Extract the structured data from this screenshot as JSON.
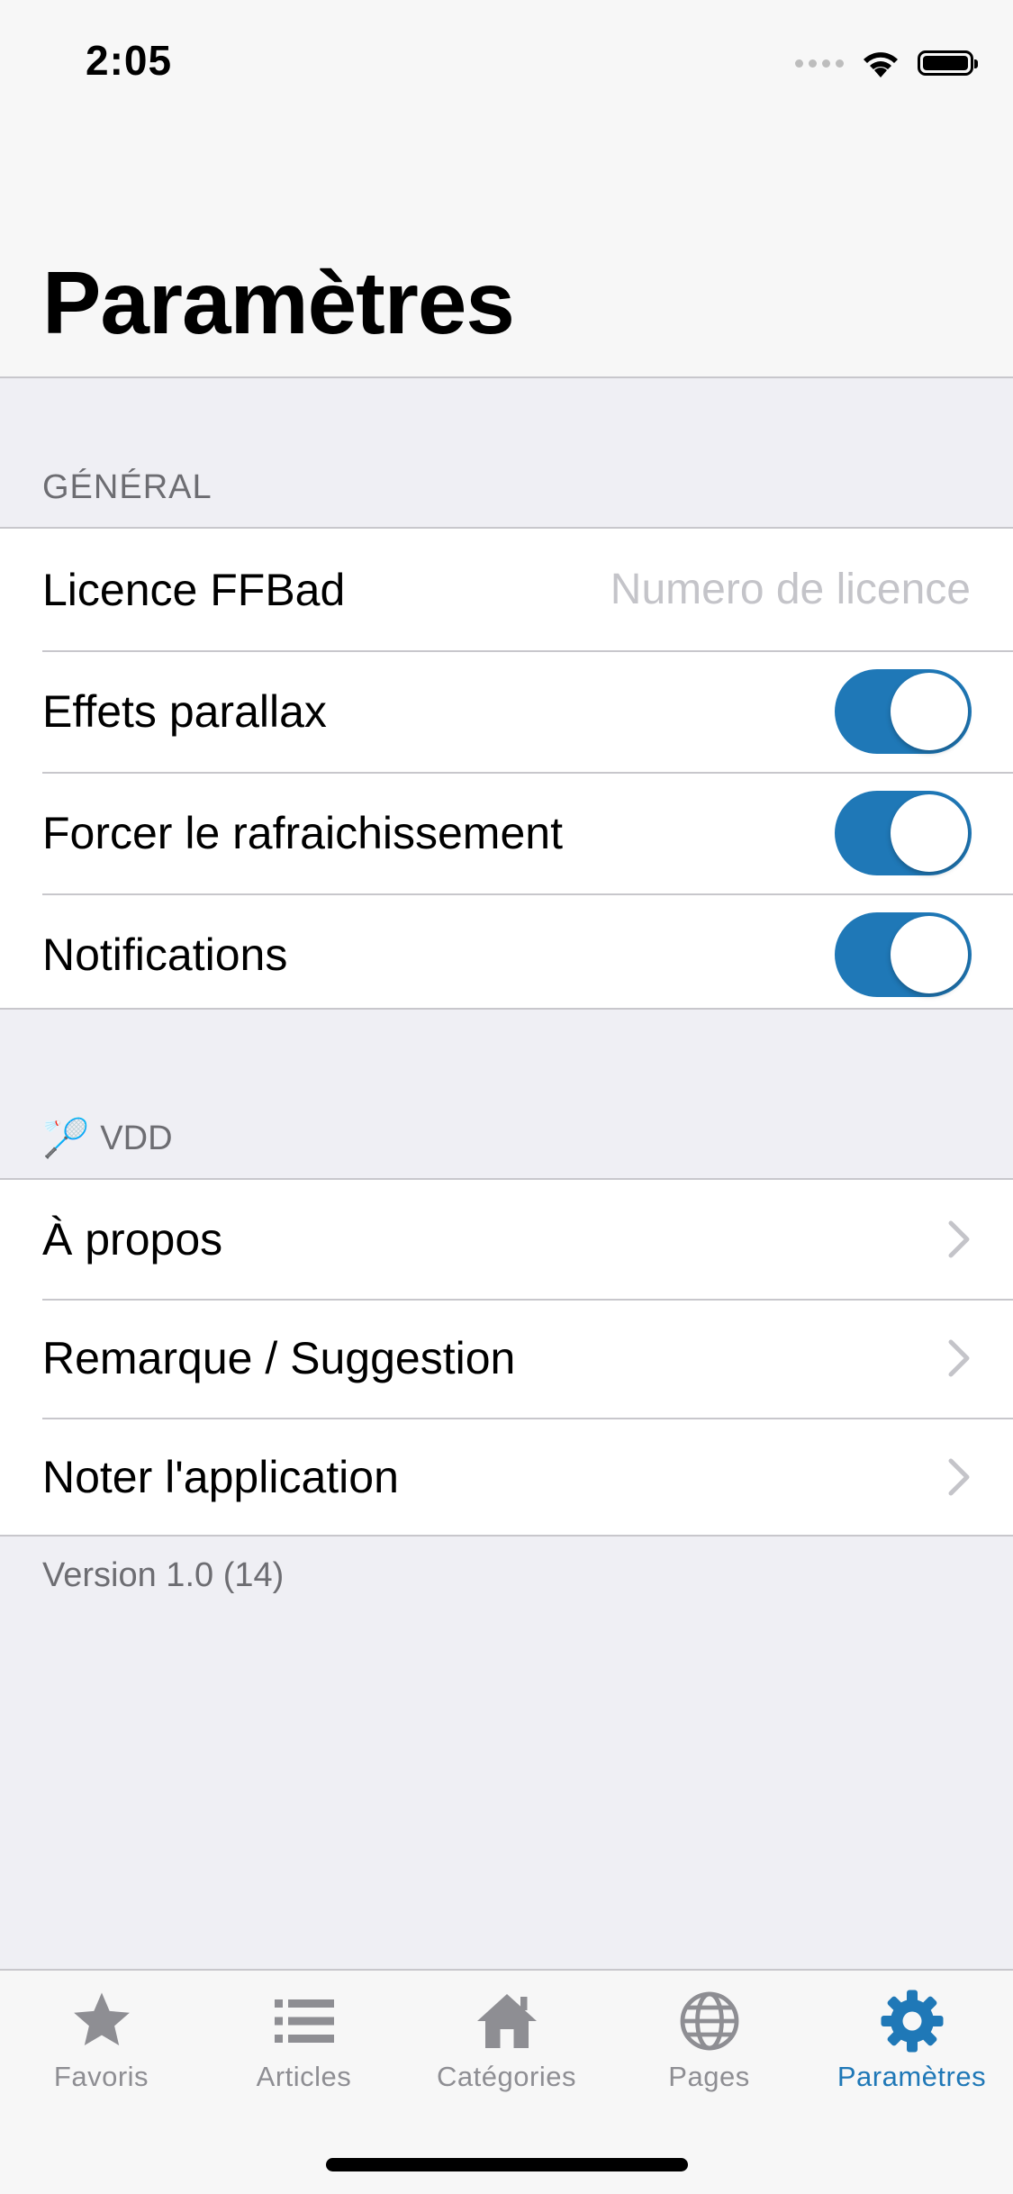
{
  "status_bar": {
    "time": "2:05"
  },
  "nav": {
    "title": "Paramètres"
  },
  "general": {
    "header": "GÉNÉRAL",
    "licence_label": "Licence FFBad",
    "licence_placeholder": "Numero de licence",
    "licence_value": "",
    "parallax_label": "Effets parallax",
    "parallax_on": true,
    "refresh_label": "Forcer le rafraichissement",
    "refresh_on": true,
    "notifications_label": "Notifications",
    "notifications_on": true
  },
  "vdd": {
    "header_emoji": "🏸",
    "header": "VDD",
    "items": [
      {
        "label": "À propos"
      },
      {
        "label": "Remarque / Suggestion"
      },
      {
        "label": "Noter l'application"
      }
    ]
  },
  "footer": {
    "version": "Version 1.0 (14)"
  },
  "tabbar": {
    "accent": "#1f78b7",
    "inactive": "#8e8e93",
    "tabs": [
      {
        "label": "Favoris",
        "icon": "star-icon"
      },
      {
        "label": "Articles",
        "icon": "list-icon"
      },
      {
        "label": "Catégories",
        "icon": "home-icon"
      },
      {
        "label": "Pages",
        "icon": "globe-icon"
      },
      {
        "label": "Paramètres",
        "icon": "gear-icon",
        "active": true
      }
    ]
  }
}
